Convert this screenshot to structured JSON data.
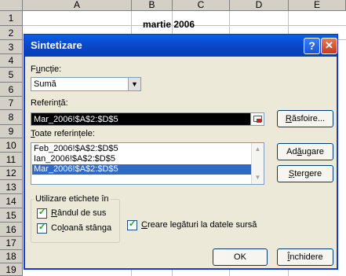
{
  "sheet": {
    "columns": [
      "A",
      "B",
      "C",
      "D",
      "E"
    ],
    "rows": [
      "1",
      "2",
      "3",
      "4",
      "5",
      "6",
      "7",
      "8",
      "9",
      "10",
      "11",
      "12",
      "13",
      "14",
      "15",
      "16",
      "17",
      "18",
      "19"
    ],
    "title_cell": "martie 2006"
  },
  "dialog": {
    "title": "Sintetizare",
    "help_glyph": "?",
    "close_glyph": "✕",
    "function": {
      "label_pre": "F",
      "label_ul": "u",
      "label_post": "ncție:",
      "value": "Sumă"
    },
    "reference": {
      "label_pre": "Referin",
      "label_ul": "ț",
      "label_post": "ă:",
      "value": "Mar_2006!$A$2:$D$5"
    },
    "all_refs": {
      "label_pre": "",
      "label_ul": "T",
      "label_post": "oate referințele:",
      "items": [
        "Feb_2006!$A$2:$D$5",
        "Ian_2006!$A$2:$D$5",
        "Mar_2006!$A$2:$D$5"
      ],
      "selected_index": 2
    },
    "buttons": {
      "browse": {
        "pre": "",
        "ul": "R",
        "post": "ăsfoire..."
      },
      "add": {
        "pre": "Ad",
        "ul": "ă",
        "post": "ugare"
      },
      "delete": {
        "pre": "",
        "ul": "Ș",
        "post": "tergere"
      },
      "ok": "OK",
      "close": {
        "pre": "",
        "ul": "Î",
        "post": "nchidere"
      }
    },
    "labels_group": {
      "title": "Utilizare etichete în",
      "top_row": {
        "pre": "",
        "ul": "R",
        "post": "ândul de sus",
        "checked": true
      },
      "left_col": {
        "pre": "Co",
        "ul": "l",
        "post": "oană stânga",
        "checked": true
      }
    },
    "create_links": {
      "pre": "",
      "ul": "C",
      "post": "reare legături la datele sursă",
      "checked": true
    }
  },
  "colors": {
    "title_bar": "#0847c8",
    "selection": "#316ac5",
    "dialog_bg": "#ece9d8"
  }
}
